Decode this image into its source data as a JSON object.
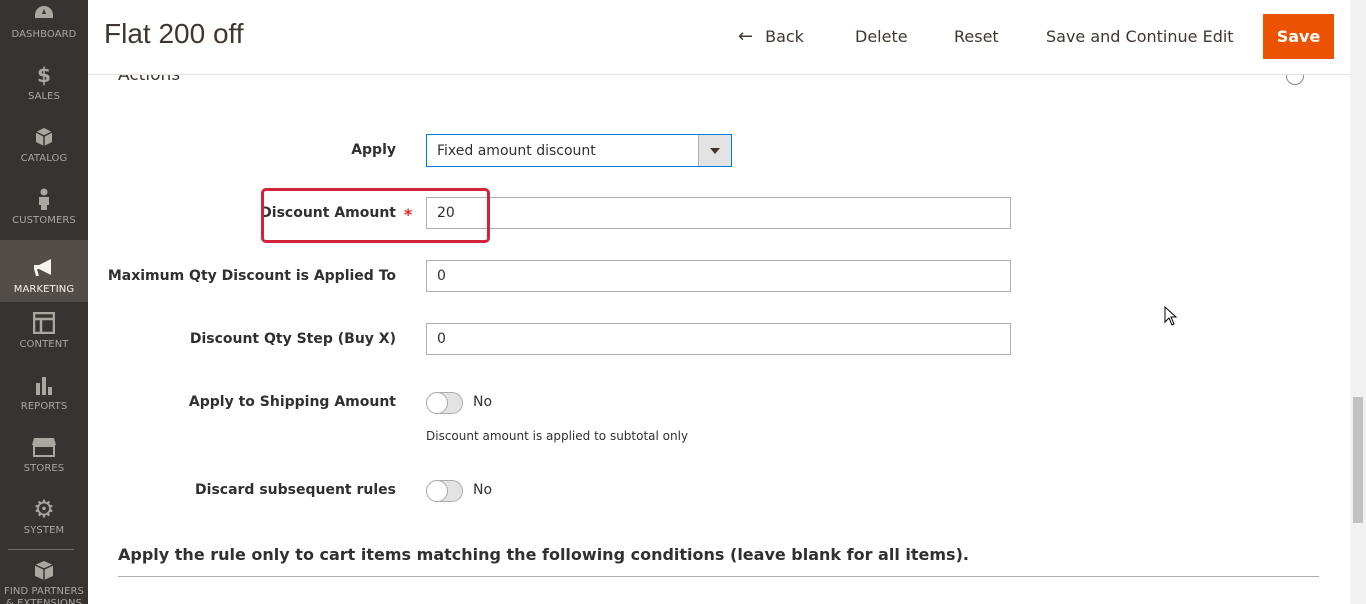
{
  "sidebar": {
    "items": [
      {
        "label": "DASHBOARD",
        "icon": "dashboard-icon"
      },
      {
        "label": "SALES",
        "icon": "dollar-icon"
      },
      {
        "label": "CATALOG",
        "icon": "cube-icon"
      },
      {
        "label": "CUSTOMERS",
        "icon": "person-icon"
      },
      {
        "label": "MARKETING",
        "icon": "megaphone-icon"
      },
      {
        "label": "CONTENT",
        "icon": "layout-icon"
      },
      {
        "label": "REPORTS",
        "icon": "bar-chart-icon"
      },
      {
        "label": "STORES",
        "icon": "store-icon"
      },
      {
        "label": "SYSTEM",
        "icon": "gear-icon"
      },
      {
        "label": "FIND PARTNERS & EXTENSIONS",
        "icon": "box-icon"
      }
    ],
    "active": "MARKETING"
  },
  "header": {
    "title": "Flat 200 off",
    "back_label": "Back",
    "delete_label": "Delete",
    "reset_label": "Reset",
    "save_continue_label": "Save and Continue Edit",
    "save_label": "Save"
  },
  "actions": {
    "section_title": "Actions",
    "apply": {
      "label": "Apply",
      "value": "Fixed amount discount"
    },
    "discount_amount": {
      "label": "Discount Amount",
      "value": "20"
    },
    "max_qty": {
      "label": "Maximum Qty Discount is Applied To",
      "value": "0"
    },
    "qty_step": {
      "label": "Discount Qty Step (Buy X)",
      "value": "0"
    },
    "apply_shipping": {
      "label": "Apply to Shipping Amount",
      "state": "No",
      "note": "Discount amount is applied to subtotal only"
    },
    "discard_rules": {
      "label": "Discard subsequent rules",
      "state": "No"
    }
  },
  "conditions": {
    "title": "Apply the rule only to cart items matching the following conditions (leave blank for all items)."
  },
  "colors": {
    "sidebar_bg": "#373330",
    "sidebar_active": "#524d49",
    "save_button": "#eb5202",
    "highlight": "#d1233a"
  }
}
